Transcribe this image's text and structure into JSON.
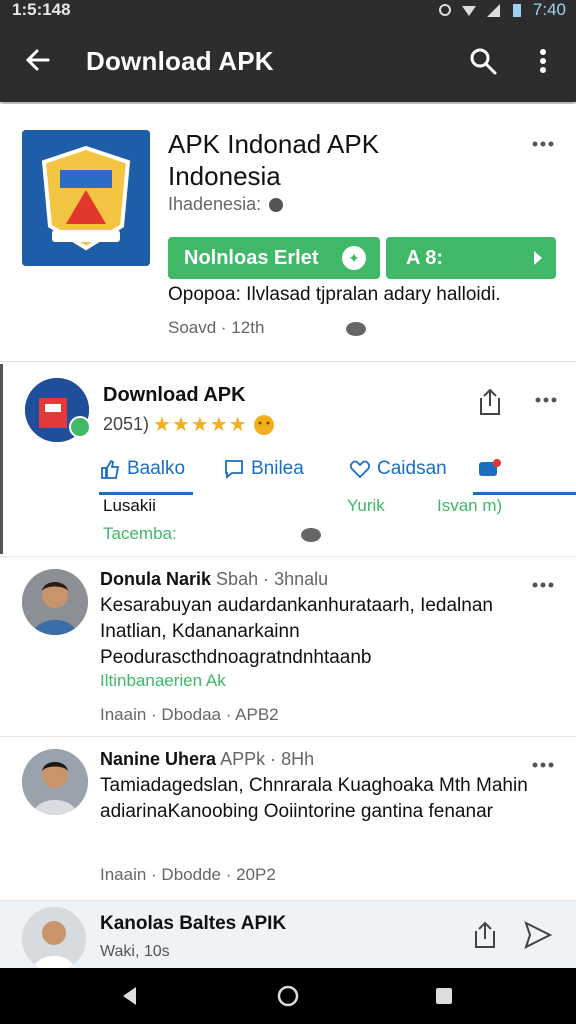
{
  "status_bar": {
    "time": "1:5:148",
    "clock": "7:40"
  },
  "app_bar": {
    "title": "Download APK"
  },
  "app_card": {
    "name": "APK Indonad APK",
    "subtitle": "Indonesia",
    "region": "Ihadenesia:",
    "download_label": "Nolnloas Erlet",
    "open_label": "A 8:",
    "description": "Opopoa: Ilvlasad tjpralan adary halloidi.",
    "meta": "Soavd · 12th",
    "icon_name": "app-emblem-icon"
  },
  "post": {
    "title": "Download APK",
    "rating_count": "2051)",
    "stars": "★★★★★",
    "actions": [
      {
        "label": "Baalko",
        "icon": "like-icon"
      },
      {
        "label": "Bnilea",
        "icon": "comment-icon"
      },
      {
        "label": "Caidsan",
        "icon": "heart-icon"
      },
      {
        "label": "",
        "icon": "chat-icon"
      }
    ],
    "sub_line": "Lusakii",
    "sub_right1": "Yurik",
    "sub_right2": "Isvan m)",
    "sub_line2": "Tacemba:"
  },
  "comments": [
    {
      "name": "Donula Narik",
      "meta": "Sbah · 3hnalu",
      "body": "Kesarabuyan audardankanhurataarh, Iedalnan Inatlian, Kdananarkainn Peodurascthdnoagratndnhtaanb",
      "link": "Iltinbanaerien Ak",
      "footer": "Inaain · Dbodaa · APB2"
    },
    {
      "name": "Nanine Uhera",
      "meta": "APPk · 8Hh",
      "body": "Tamiadagedslan, Chnrarala Kuaghoaka Mth Mahin adiarinaKanoobing Ooiintorine gantina fenanar",
      "link": "",
      "footer": "Inaain · Dbodde · 20P2"
    }
  ],
  "bottom_bar": {
    "title": "Kanolas Baltes APIK",
    "subtitle": "Waki, 10s"
  },
  "colors": {
    "accent_green": "#3fb868",
    "link_blue": "#1a6fc2",
    "appbar": "#2d2d2d",
    "star": "#f2b01e"
  }
}
